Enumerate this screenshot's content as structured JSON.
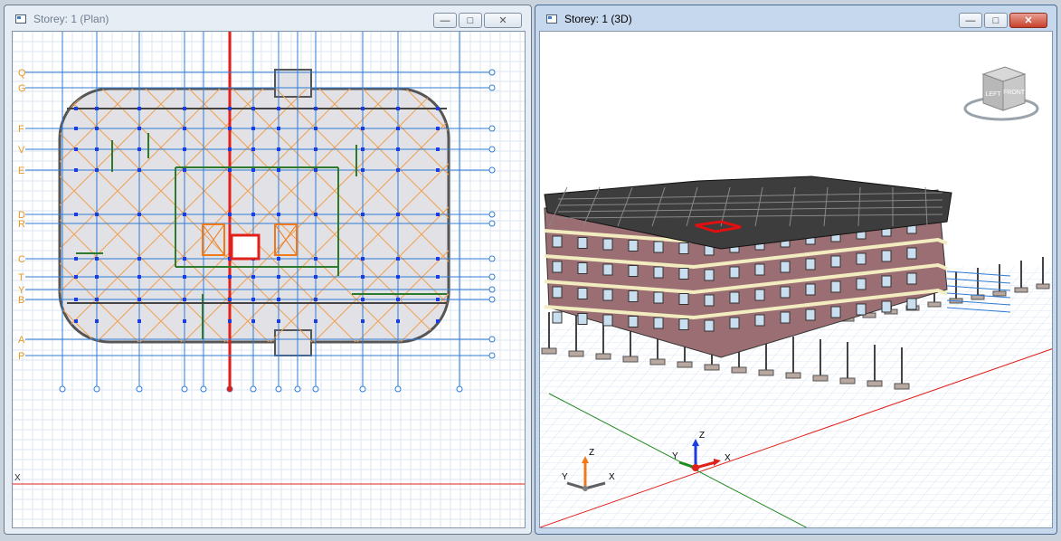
{
  "left_window": {
    "title": "Storey: 1 (Plan)",
    "minimize_icon": "minimize-icon",
    "maximize_icon": "maximize-icon",
    "close_icon": "close-icon",
    "grid_labels": [
      "Q",
      "G",
      "F",
      "V",
      "E",
      "D",
      "R",
      "C",
      "T",
      "Y",
      "B",
      "A",
      "P"
    ],
    "axis_x_label": "X"
  },
  "right_window": {
    "title": "Storey: 1 (3D)",
    "minimize_icon": "minimize-icon",
    "maximize_icon": "maximize-icon",
    "close_icon": "close-icon",
    "view_cube": {
      "left_face": "LEFT",
      "front_face": "FRONT"
    },
    "triad_small": {
      "x": "X",
      "y": "Y",
      "z": "Z"
    },
    "triad_origin": {
      "x": "X",
      "y": "Y",
      "z": "Z"
    }
  },
  "colors": {
    "grid_line": "#2f7bd6",
    "grid_label": "#e8981e",
    "axis_x": "#e0201b",
    "axis_y": "#1f8a1f",
    "slab_fill": "#e2e2e6",
    "roof_tile": "#3d3d3d",
    "facade": "#9a6e72",
    "selection": "#e01010"
  }
}
